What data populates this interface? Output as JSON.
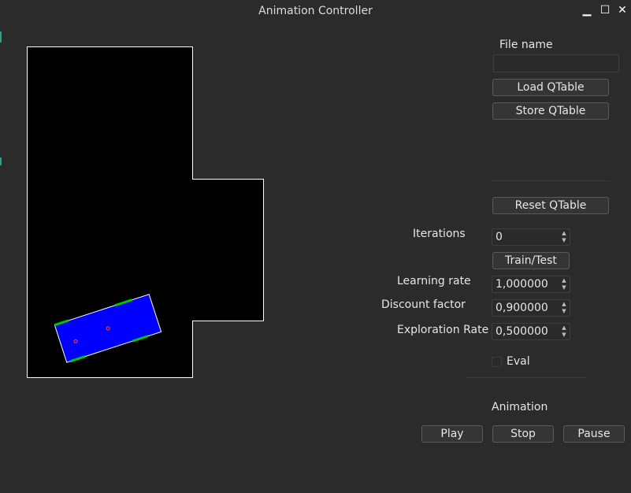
{
  "window": {
    "title": "Animation Controller"
  },
  "file": {
    "label": "File name",
    "value": "",
    "load_label": "Load QTable",
    "store_label": "Store QTable"
  },
  "reset_label": "Reset QTable",
  "iterations": {
    "label": "Iterations",
    "value": "0"
  },
  "train_label": "Train/Test",
  "learning_rate": {
    "label": "Learning rate",
    "value": "1,000000"
  },
  "discount_factor": {
    "label": "Discount factor",
    "value": "0,900000"
  },
  "exploration_rate": {
    "label": "Exploration Rate",
    "value": "0,500000"
  },
  "eval": {
    "label": "Eval",
    "checked": false
  },
  "animation": {
    "label": "Animation",
    "play_label": "Play",
    "stop_label": "Stop",
    "pause_label": "Pause"
  },
  "colors": {
    "background": "#2b2b2b",
    "canvas": "#000000",
    "vehicle": "#0000ff",
    "sensor": "#00c800",
    "marker": "#ff2020"
  },
  "icons": {
    "minimize": "minimize-icon",
    "maximize": "maximize-icon",
    "close": "close-icon"
  }
}
